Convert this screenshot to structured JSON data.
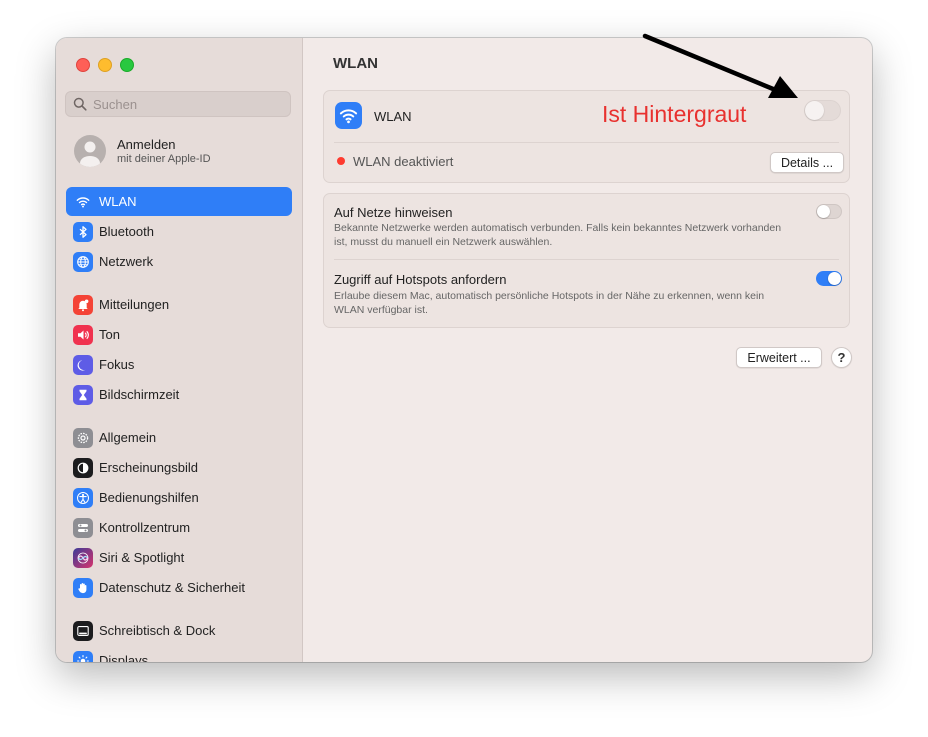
{
  "sidebar": {
    "search_placeholder": "Suchen",
    "account": {
      "title": "Anmelden",
      "subtitle": "mit deiner Apple-ID"
    },
    "items": [
      {
        "label": "WLAN",
        "icon": "wifi-icon",
        "color": "#2f7ef7",
        "selected": true
      },
      {
        "label": "Bluetooth",
        "icon": "bluetooth-icon",
        "color": "#2f7ef7"
      },
      {
        "label": "Netzwerk",
        "icon": "globe-icon",
        "color": "#2f7ef7"
      },
      {
        "label": "Mitteilungen",
        "icon": "bell-icon",
        "color": "#f44336"
      },
      {
        "label": "Ton",
        "icon": "speaker-icon",
        "color": "#f0324f"
      },
      {
        "label": "Fokus",
        "icon": "moon-icon",
        "color": "#5e5ce6"
      },
      {
        "label": "Bildschirmzeit",
        "icon": "hourglass-icon",
        "color": "#5e5ce6"
      },
      {
        "label": "Allgemein",
        "icon": "gear-icon",
        "color": "#8e8e93"
      },
      {
        "label": "Erscheinungsbild",
        "icon": "appearance-icon",
        "color": "#1c1c1e"
      },
      {
        "label": "Bedienungshilfen",
        "icon": "accessibility-icon",
        "color": "#2f7ef7"
      },
      {
        "label": "Kontrollzentrum",
        "icon": "control-center-icon",
        "color": "#8e8e93"
      },
      {
        "label": "Siri & Spotlight",
        "icon": "siri-icon",
        "color": "#b03fd9"
      },
      {
        "label": "Datenschutz & Sicherheit",
        "icon": "hand-icon",
        "color": "#2f7ef7"
      },
      {
        "label": "Schreibtisch & Dock",
        "icon": "dock-icon",
        "color": "#1c1c1e"
      },
      {
        "label": "Displays",
        "icon": "display-icon",
        "color": "#2f7ef7"
      }
    ]
  },
  "main": {
    "title": "WLAN",
    "wlan_card": {
      "label": "WLAN",
      "toggle_on": false,
      "status": "WLAN deaktiviert",
      "details_button": "Details ..."
    },
    "options": [
      {
        "title": "Auf Netze hinweisen",
        "description": "Bekannte Netzwerke werden automatisch verbunden. Falls kein bekanntes Netzwerk vorhanden ist, musst du manuell ein Netzwerk auswählen.",
        "toggle_on": false
      },
      {
        "title": "Zugriff auf Hotspots anfordern",
        "description": "Erlaube diesem Mac, automatisch persönliche Hotspots in der Nähe zu erkennen, wenn kein WLAN verfügbar ist.",
        "toggle_on": true
      }
    ],
    "advanced_button": "Erweitert ...",
    "help_button": "?"
  },
  "annotation": {
    "text": "Ist Hintergraut",
    "color": "#e8312f"
  }
}
